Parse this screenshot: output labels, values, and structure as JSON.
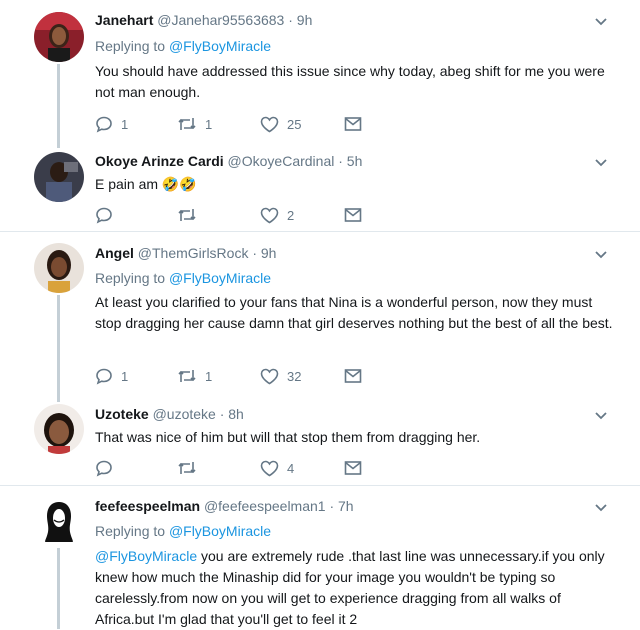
{
  "tweets": [
    {
      "name": "Janehart",
      "handle": "@Janehar95563683",
      "time": "· 9h",
      "replying_label": "Replying to",
      "replying_to": "@FlyBoyMiracle",
      "text": "You should have addressed this issue since why today, abeg shift for me you were not man enough.",
      "replies": "1",
      "retweets": "1",
      "likes": "25"
    },
    {
      "name": "Okoye Arinze Cardi",
      "handle": "@OkoyeCardinal",
      "time": "· 5h",
      "text": "E pain am 🤣🤣",
      "replies": "",
      "retweets": "",
      "likes": "2"
    },
    {
      "name": "Angel",
      "handle": "@ThemGirlsRock",
      "time": "· 9h",
      "replying_label": "Replying to",
      "replying_to": "@FlyBoyMiracle",
      "text": "At least you clarified to your fans that Nina is a wonderful person, now they must stop dragging her cause damn that girl deserves nothing but the best of all the best.",
      "replies": "1",
      "retweets": "1",
      "likes": "32"
    },
    {
      "name": "Uzoteke",
      "handle": "@uzoteke",
      "time": "· 8h",
      "text": "That was nice of him but will that stop them from dragging her.",
      "replies": "",
      "retweets": "",
      "likes": "4"
    },
    {
      "name": "feefeespeelman",
      "handle": "@feefeespeelman1",
      "time": "· 7h",
      "replying_label": "Replying to",
      "replying_to": "@FlyBoyMiracle",
      "text_mention": "@FlyBoyMiracle",
      "text": " you are extremely rude .that last line was unnecessary.if you only knew how much the Minaship did for your image you wouldn't be typing so carelessly.from now on you will get to experience dragging from all walks of Africa.but I'm glad that you'll get to feel it 2"
    }
  ]
}
